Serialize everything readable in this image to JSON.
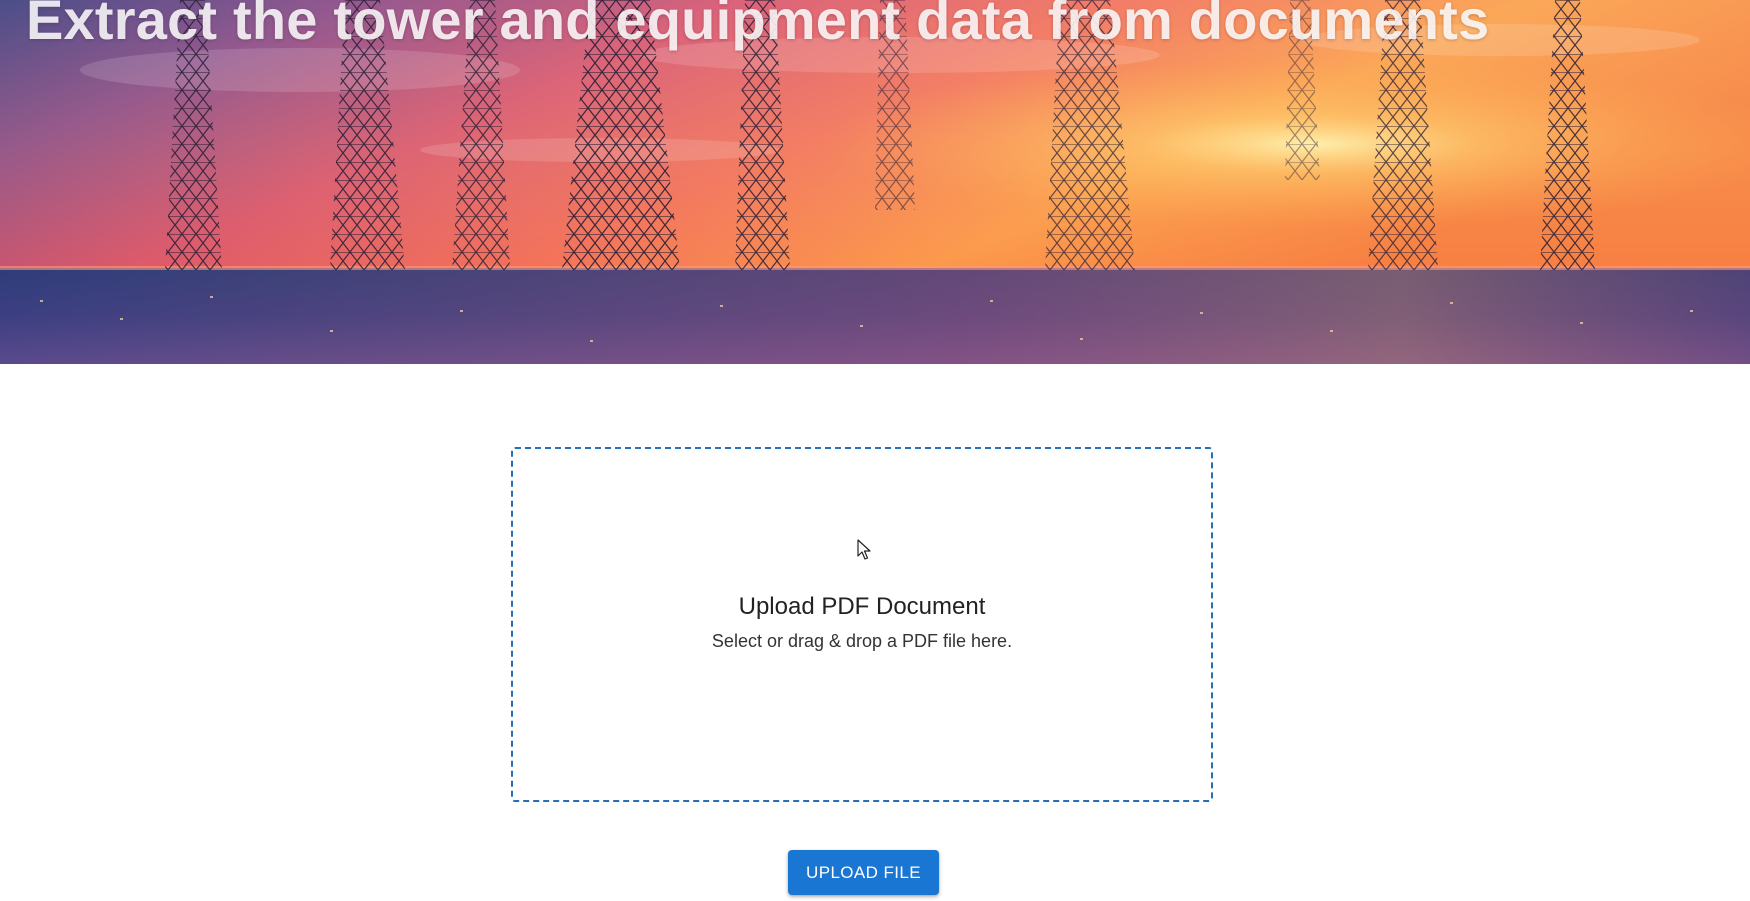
{
  "hero": {
    "title": "Extract the tower and equipment data from documents",
    "image": "telecom-towers-sunset-background"
  },
  "upload": {
    "title": "Upload PDF Document",
    "subtitle": "Select or drag & drop a PDF file here.",
    "button_label": "UPLOAD FILE"
  },
  "colors": {
    "accent": "#1976d2",
    "dropzone_border": "#2a6fb5",
    "text": "#222222"
  }
}
